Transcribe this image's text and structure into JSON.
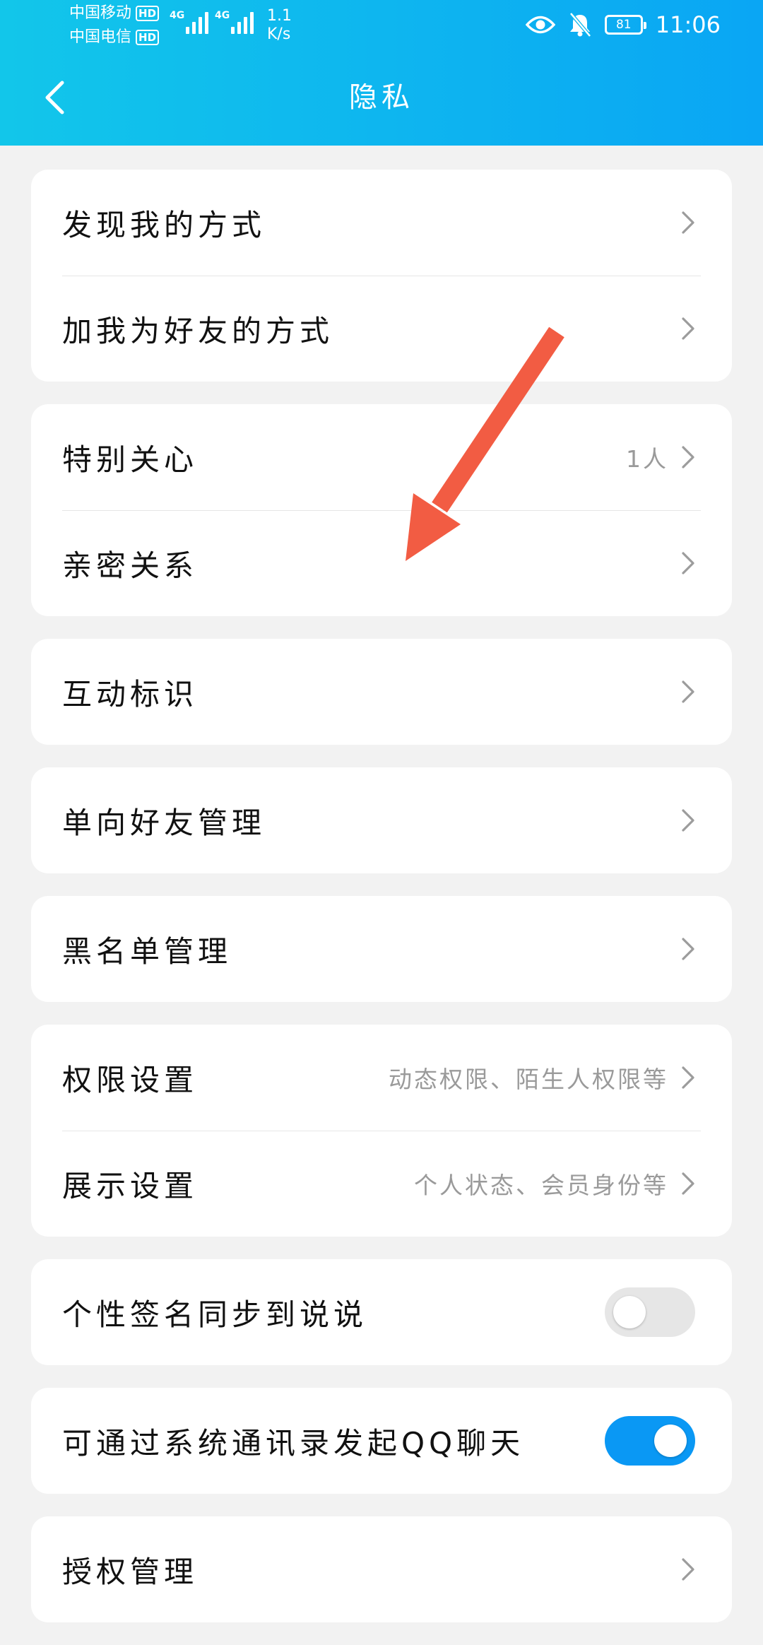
{
  "status_bar": {
    "carrier_1": "中国移动",
    "carrier_2": "中国电信",
    "hd_label": "HD",
    "network_1": "4G",
    "network_2": "4G",
    "net_speed_value": "1.1",
    "net_speed_unit": "K/s",
    "battery_level": "81",
    "time": "11:06"
  },
  "header": {
    "title": "隐私",
    "back_icon": "chevron-left-icon"
  },
  "groups": [
    [
      {
        "label": "发现我的方式"
      },
      {
        "label": "加我为好友的方式"
      }
    ],
    [
      {
        "label": "特别关心",
        "value": "1人"
      },
      {
        "label": "亲密关系"
      }
    ],
    [
      {
        "label": "互动标识"
      }
    ],
    [
      {
        "label": "单向好友管理"
      }
    ],
    [
      {
        "label": "黑名单管理"
      }
    ],
    [
      {
        "label": "权限设置",
        "value": "动态权限、陌生人权限等"
      },
      {
        "label": "展示设置",
        "value": "个人状态、会员身份等"
      }
    ],
    [
      {
        "label": "个性签名同步到说说",
        "toggle": "off"
      }
    ],
    [
      {
        "label": "可通过系统通讯录发起QQ聊天",
        "toggle": "on"
      }
    ],
    [
      {
        "label": "授权管理"
      }
    ]
  ],
  "colors": {
    "header_start": "#12c6ea",
    "header_end": "#0aa6f4",
    "toggle_on": "#0a98f4",
    "annotation_arrow": "#f25c43"
  },
  "icons": {
    "row_chevron": "chevron-right-icon",
    "annotation": "red-arrow-annotation"
  }
}
